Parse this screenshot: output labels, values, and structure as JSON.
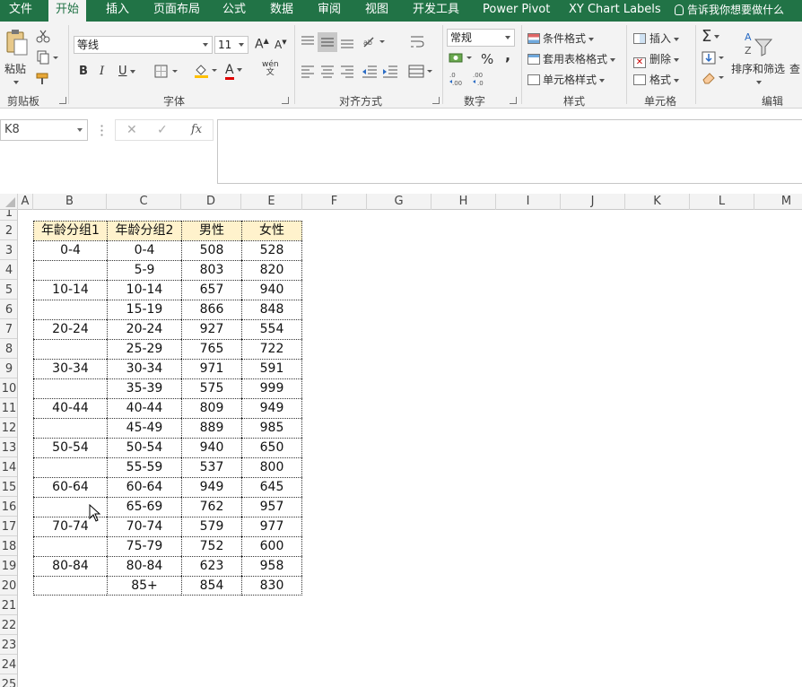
{
  "tabs": [
    {
      "label": "文件",
      "active": false
    },
    {
      "label": "开始",
      "active": true
    },
    {
      "label": "插入",
      "active": false
    },
    {
      "label": "页面布局",
      "active": false
    },
    {
      "label": "公式",
      "active": false
    },
    {
      "label": "数据",
      "active": false
    },
    {
      "label": "审阅",
      "active": false
    },
    {
      "label": "视图",
      "active": false
    },
    {
      "label": "开发工具",
      "active": false
    },
    {
      "label": "Power Pivot",
      "active": false
    },
    {
      "label": "XY Chart Labels",
      "active": false
    }
  ],
  "tell_me": "告诉我你想要做什么",
  "ribbon": {
    "clipboard": {
      "group": "剪贴板",
      "paste": "粘贴"
    },
    "font": {
      "group": "字体",
      "font_name": "等线",
      "font_size": "11",
      "bold": "B",
      "italic": "I",
      "underline": "U",
      "font_color_glyph": "A",
      "phonetic_glyph": "wén"
    },
    "alignment": {
      "group": "对齐方式"
    },
    "number": {
      "group": "数字",
      "format": "常规",
      "percent": "%",
      "comma": ","
    },
    "styles": {
      "group": "样式",
      "conditional": "条件格式",
      "table_format": "套用表格格式",
      "cell_styles": "单元格样式"
    },
    "cells": {
      "group": "单元格",
      "insert": "插入",
      "delete": "删除",
      "format": "格式"
    },
    "editing": {
      "group": "编辑",
      "sort_filter": "排序和筛选",
      "find": "查"
    }
  },
  "formula_bar": {
    "name_box": "K8",
    "cancel": "✕",
    "enter": "✓",
    "fx": "fx",
    "formula": ""
  },
  "columns": [
    "A",
    "B",
    "C",
    "D",
    "E",
    "F",
    "G",
    "H",
    "I",
    "J",
    "K",
    "L",
    "M"
  ],
  "rows": [
    "1",
    "2",
    "3",
    "4",
    "5",
    "6",
    "7",
    "8",
    "9",
    "10",
    "11",
    "12",
    "13",
    "14",
    "15",
    "16",
    "17",
    "18",
    "19",
    "20",
    "21",
    "22",
    "23",
    "24",
    "25"
  ],
  "table": {
    "headers": [
      "年龄分组1",
      "年龄分组2",
      "男性",
      "女性"
    ],
    "rows": [
      [
        "0-4",
        "0-4",
        "508",
        "528"
      ],
      [
        "",
        "5-9",
        "803",
        "820"
      ],
      [
        "10-14",
        "10-14",
        "657",
        "940"
      ],
      [
        "",
        "15-19",
        "866",
        "848"
      ],
      [
        "20-24",
        "20-24",
        "927",
        "554"
      ],
      [
        "",
        "25-29",
        "765",
        "722"
      ],
      [
        "30-34",
        "30-34",
        "971",
        "591"
      ],
      [
        "",
        "35-39",
        "575",
        "999"
      ],
      [
        "40-44",
        "40-44",
        "809",
        "949"
      ],
      [
        "",
        "45-49",
        "889",
        "985"
      ],
      [
        "50-54",
        "50-54",
        "940",
        "650"
      ],
      [
        "",
        "55-59",
        "537",
        "800"
      ],
      [
        "60-64",
        "60-64",
        "949",
        "645"
      ],
      [
        "",
        "65-69",
        "762",
        "957"
      ],
      [
        "70-74",
        "70-74",
        "579",
        "977"
      ],
      [
        "",
        "75-79",
        "752",
        "600"
      ],
      [
        "80-84",
        "80-84",
        "623",
        "958"
      ],
      [
        "",
        "85+",
        "854",
        "830"
      ]
    ]
  },
  "colors": {
    "excel_green": "#217346",
    "header_fill": "#fff2cc"
  }
}
